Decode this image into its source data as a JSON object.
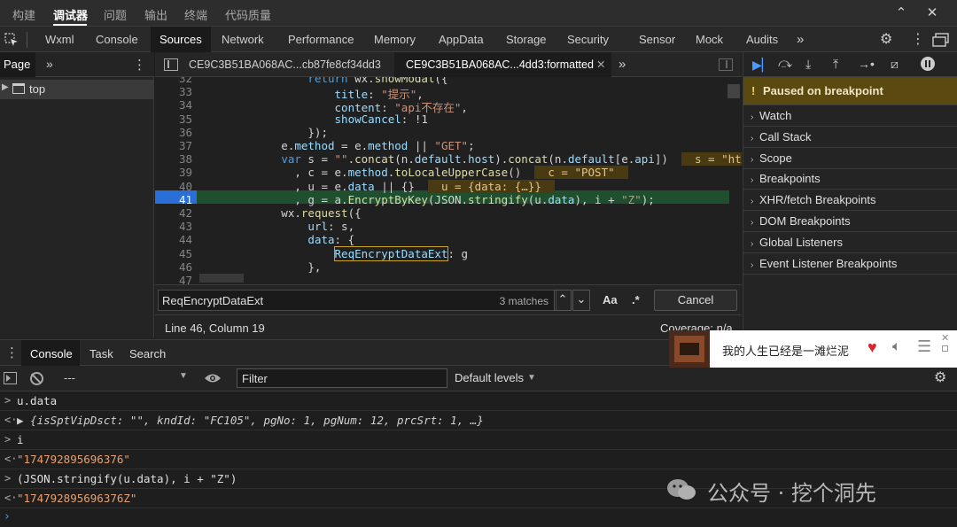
{
  "top_menu": {
    "items": [
      "构建",
      "调试器",
      "问题",
      "输出",
      "终端",
      "代码质量"
    ],
    "active_index": 1
  },
  "devtools_tabs": {
    "items": [
      "Wxml",
      "Console",
      "Sources",
      "Network",
      "Performance",
      "Memory",
      "AppData",
      "Storage",
      "Security",
      "Sensor",
      "Mock",
      "Audits"
    ],
    "active": "Sources"
  },
  "page_panel": {
    "tab_label": "Page",
    "tree_item": "top"
  },
  "editor_tabs": [
    {
      "label": "CE9C3B51BA068AC...cb87fe8cf34dd3",
      "active": false
    },
    {
      "label": "CE9C3B51BA068AC...4dd3:formatted",
      "active": true
    }
  ],
  "code_lines": [
    {
      "n": "32",
      "text": "                return wx.showModal({"
    },
    {
      "n": "33",
      "text": "                    title: \"提示\","
    },
    {
      "n": "34",
      "text": "                    content: \"api不存在\","
    },
    {
      "n": "35",
      "text": "                    showCancel: !1"
    },
    {
      "n": "36",
      "text": "                });"
    },
    {
      "n": "37",
      "text": "            e.method = e.method || \"GET\";"
    },
    {
      "n": "38",
      "text": "            var s = \"\".concat(n.default.host).concat(n.default[e.api])"
    },
    {
      "n": "39",
      "text": "              , c = e.method.toLocaleUpperCase()"
    },
    {
      "n": "40",
      "text": "              , u = e.data || {}"
    },
    {
      "n": "41",
      "text": "              , g = a.EncryptByKey(JSON.stringify(u.data), i + \"Z\");"
    },
    {
      "n": "42",
      "text": "            wx.request({"
    },
    {
      "n": "43",
      "text": "                url: s,"
    },
    {
      "n": "44",
      "text": "                data: {"
    },
    {
      "n": "45",
      "text": "                    ReqEncryptDataExt: g"
    },
    {
      "n": "46",
      "text": "                },"
    },
    {
      "n": "47",
      "text": ""
    }
  ],
  "inline_values": {
    "line38": "s = \"https:/",
    "line39": "c = \"POST\"",
    "line40": "u = {data: {…}}"
  },
  "search": {
    "query": "ReqEncryptDataExt",
    "matches": "3 matches",
    "case_label": "Aa",
    "regex_label": ".*",
    "cancel_label": "Cancel"
  },
  "status": {
    "position": "Line 46, Column 19",
    "coverage": "Coverage: n/a"
  },
  "debugger": {
    "paused_label": "Paused on breakpoint",
    "sections": [
      "Watch",
      "Call Stack",
      "Scope",
      "Breakpoints",
      "XHR/fetch Breakpoints",
      "DOM Breakpoints",
      "Global Listeners",
      "Event Listener Breakpoints"
    ]
  },
  "console_tabs": {
    "items": [
      "Console",
      "Task",
      "Search"
    ],
    "active": "Console"
  },
  "console_toolbar": {
    "context": "---",
    "filter_placeholder": "Filter",
    "levels": "Default levels"
  },
  "console_log": [
    {
      "prefix": ">",
      "text": "u.data"
    },
    {
      "prefix": "<·",
      "text": "▶ {isSptVipDsct: \"\", kndId: \"FC105\", pgNo: 1, pgNum: 12, prcSrt: 1, …}"
    },
    {
      "prefix": ">",
      "text": "i"
    },
    {
      "prefix": "<·",
      "text": "\"174792895696376\""
    },
    {
      "prefix": ">",
      "text": "(JSON.stringify(u.data), i + \"Z\")"
    },
    {
      "prefix": "<·",
      "text": "\"174792895696376Z\""
    }
  ],
  "music_popup": {
    "song_text": "我的人生已经是一滩烂泥"
  },
  "watermark": "公众号 · 挖个洞先"
}
